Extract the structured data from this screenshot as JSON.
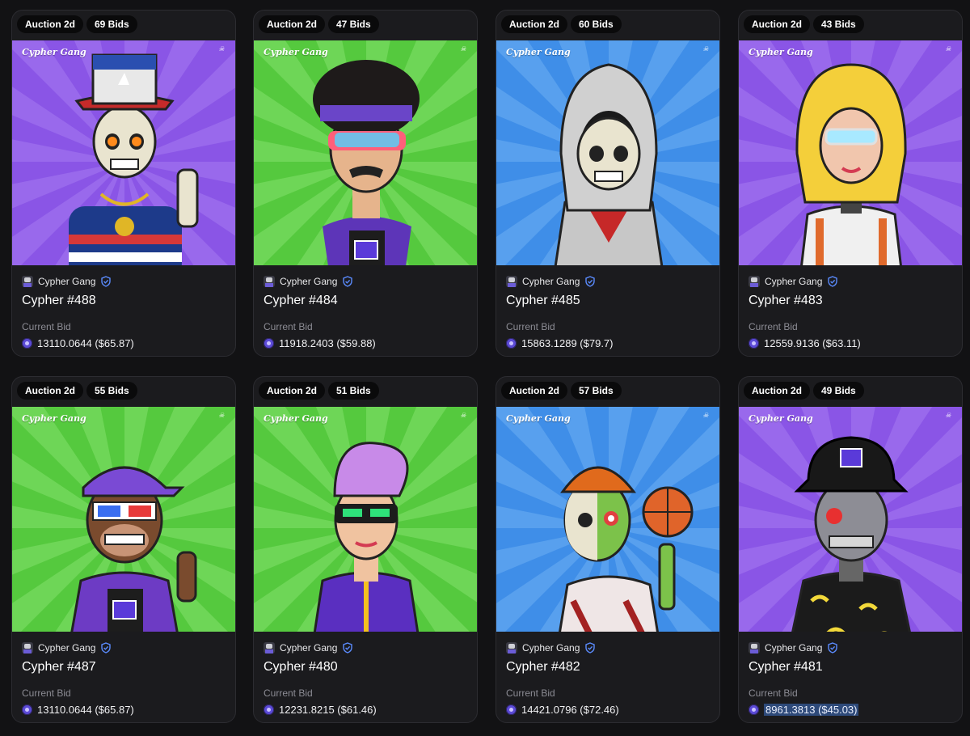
{
  "cards": [
    {
      "badge_time": "Auction 2d",
      "badge_bids": "69 Bids",
      "collection": "Cypher Gang",
      "title": "Cypher #488",
      "bid_label": "Current Bid",
      "bid_value": "13110.0644 ($65.87)",
      "bg": "#8a55e6",
      "char": "skull-uncle-sam"
    },
    {
      "badge_time": "Auction 2d",
      "badge_bids": "47 Bids",
      "collection": "Cypher Gang",
      "title": "Cypher #484",
      "bid_label": "Current Bid",
      "bid_value": "11918.2403 ($59.88)",
      "bg": "#55c93e",
      "char": "afro-visor"
    },
    {
      "badge_time": "Auction 2d",
      "badge_bids": "60 Bids",
      "collection": "Cypher Gang",
      "title": "Cypher #485",
      "bid_label": "Current Bid",
      "bid_value": "15863.1289 ($79.7)",
      "bg": "#3f8ee8",
      "char": "hooded-skull"
    },
    {
      "badge_time": "Auction 2d",
      "badge_bids": "43 Bids",
      "collection": "Cypher Gang",
      "title": "Cypher #483",
      "bid_label": "Current Bid",
      "bid_value": "12559.9136 ($63.11)",
      "bg": "#8a55e6",
      "char": "blonde-cyborg"
    },
    {
      "badge_time": "Auction 2d",
      "badge_bids": "55 Bids",
      "collection": "Cypher Gang",
      "title": "Cypher #487",
      "bid_label": "Current Bid",
      "bid_value": "13110.0644 ($65.87)",
      "bg": "#55c93e",
      "char": "ape-3d-glasses"
    },
    {
      "badge_time": "Auction 2d",
      "badge_bids": "51 Bids",
      "collection": "Cypher Gang",
      "title": "Cypher #480",
      "bid_label": "Current Bid",
      "bid_value": "12231.8215 ($61.46)",
      "bg": "#55c93e",
      "char": "purple-hair-visor"
    },
    {
      "badge_time": "Auction 2d",
      "badge_bids": "57 Bids",
      "collection": "Cypher Gang",
      "title": "Cypher #482",
      "bid_label": "Current Bid",
      "bid_value": "14421.0796 ($72.46)",
      "bg": "#3f8ee8",
      "char": "zombie-basketball"
    },
    {
      "badge_time": "Auction 2d",
      "badge_bids": "49 Bids",
      "collection": "Cypher Gang",
      "title": "Cypher #481",
      "bid_label": "Current Bid",
      "bid_value": "8961.3813 ($45.03)",
      "bg": "#8a55e6",
      "char": "robot-ape-bucket-hat",
      "selected": true
    }
  ],
  "art_brand": "Cypher Gang",
  "art_seal": "Cypher Syndicate",
  "icons": {
    "collection": "collection-avatar-icon",
    "verified": "verified-badge-icon",
    "currency": "coin-icon"
  }
}
